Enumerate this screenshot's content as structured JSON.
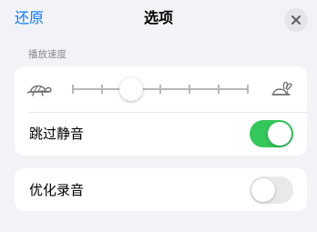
{
  "header": {
    "restore_label": "还原",
    "title": "选项",
    "close_icon": "close-icon"
  },
  "playback_speed": {
    "section_label": "播放速度",
    "slow_icon": "turtle-icon",
    "fast_icon": "rabbit-icon",
    "tick_count": 7,
    "selected_index": 2
  },
  "skip_silence": {
    "label": "跳过静音",
    "enabled": true
  },
  "enhance_audio": {
    "label": "优化录音",
    "enabled": false
  },
  "colors": {
    "accent": "#0a7aff",
    "toggle_on": "#34c759",
    "toggle_off": "#e9e9eb",
    "background": "#f2f2f7"
  }
}
